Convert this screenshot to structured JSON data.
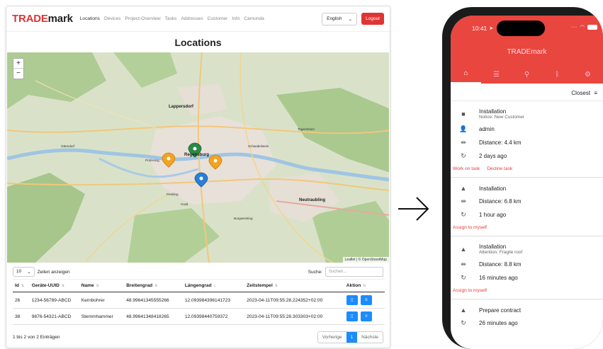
{
  "web": {
    "brand_part1": "TRADE",
    "brand_part2": "mark",
    "nav": [
      "Locations",
      "Devices",
      "Project-Overview",
      "Tasks",
      "Addresses",
      "Customer",
      "Info",
      "Camunda"
    ],
    "language": "English",
    "logout": "Logout",
    "page_title": "Locations",
    "map": {
      "zoom_in": "+",
      "zoom_out": "−",
      "attribution": "Leaflet | © OpenStreetMap",
      "labels": {
        "lappersdorf": "Lappersdorf",
        "regensburg": "Regensburg",
        "schwabelweis": "Schwabelweis",
        "pentling": "Pentling",
        "burgweinting": "Burgweinting",
        "neutraubling": "Neutraubling",
        "prüfening": "Prüfening",
        "grass": "Graß",
        "ottendorf": "Ottendorf",
        "tegernheim": "Tegernheim"
      }
    },
    "table": {
      "length_value": "10",
      "length_label": "Zeilen anzeigen",
      "search_label": "Suche:",
      "search_placeholder": "Suchen...",
      "headers": [
        "Id",
        "Geräte-UUID",
        "Name",
        "Breitengrad",
        "Längengrad",
        "Zeitstempel",
        "Aktion"
      ],
      "rows": [
        [
          "26",
          "1234-56789-ABCD",
          "Kernbohrer",
          "48.99641345555266",
          "12.093984396141723",
          "2023-04-11T09:55:28.224352+02:00"
        ],
        [
          "38",
          "9876-54321-ABCD",
          "Stemmhammer",
          "48.99641348418265",
          "12.09398440759372",
          "2023-04-11T09:55:28.303303+02:00"
        ]
      ],
      "info": "1 bis 2 von 2 Einträgen",
      "prev": "Vorherige",
      "page": "1",
      "next": "Nächste"
    }
  },
  "phone": {
    "time": "10:41",
    "title": "TRADEmark",
    "sort_label": "Closest",
    "tasks": [
      {
        "title": "Installation",
        "notice": "Notice: New Customer",
        "user": "admin",
        "distance": "Distance: 4.4 km",
        "time": "2 days ago",
        "link1": "Work on task",
        "link2": "Decline task"
      },
      {
        "title": "Installation",
        "distance": "Distance: 6.8 km",
        "time": "1 hour ago",
        "link1": "Assign to myself"
      },
      {
        "title": "Installation",
        "notice": "Attention: Fragile roof",
        "distance": "Distance: 8.8 km",
        "time": "16 minutes ago",
        "link1": "Assign to myself"
      },
      {
        "title": "Prepare contract",
        "time": "26 minutes ago"
      }
    ]
  },
  "colors": {
    "brand_red": "#e03434",
    "app_red": "#e8463e",
    "action_blue": "#1a8cff"
  }
}
